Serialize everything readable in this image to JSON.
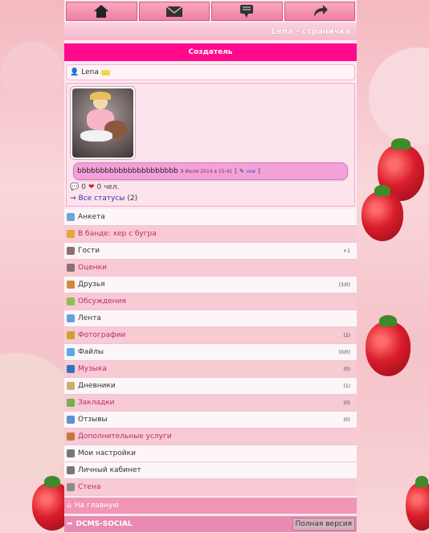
{
  "header": {
    "nav": [
      {
        "name": "home-icon"
      },
      {
        "name": "mail-icon"
      },
      {
        "name": "chat-icon"
      },
      {
        "name": "back-arrow-icon"
      }
    ],
    "page_title": "Lena - страничка"
  },
  "creator_label": "Создатель",
  "user": {
    "name": "Lena",
    "rank_badge": "...."
  },
  "status": {
    "text": "bbbbbbbbbbbbbbbbbbbbbb",
    "date": "9 Июля 2014 в 15:41",
    "new_label": "нов",
    "likes_count": "0",
    "people_count": "0 чел.",
    "all_statuses_label": "Все статусы",
    "all_statuses_count": "(2)"
  },
  "menu": [
    {
      "label": "Анкета",
      "style": "light",
      "icon": "user-icon",
      "count": ""
    },
    {
      "label": "В банде: хер с бугра",
      "style": "pink",
      "icon": "gang-icon",
      "count": ""
    },
    {
      "label": "Гости",
      "style": "light",
      "icon": "guests-icon",
      "count": "+1"
    },
    {
      "label": "Оценки",
      "style": "pink",
      "icon": "ratings-icon",
      "count": ""
    },
    {
      "label": "Друзья",
      "style": "light",
      "icon": "friends-icon",
      "count": "(3/0)"
    },
    {
      "label": "Обсуждения",
      "style": "pink",
      "icon": "discussions-icon",
      "count": ""
    },
    {
      "label": "Лента",
      "style": "light",
      "icon": "feed-icon",
      "count": ""
    },
    {
      "label": "Фотографии",
      "style": "pink",
      "icon": "photos-icon",
      "count": "(2)"
    },
    {
      "label": "Файлы",
      "style": "light",
      "icon": "files-icon",
      "count": "(0/0)"
    },
    {
      "label": "Музыка",
      "style": "pink",
      "icon": "music-icon",
      "count": "(0)"
    },
    {
      "label": "Дневники",
      "style": "light",
      "icon": "diary-icon",
      "count": "(1)"
    },
    {
      "label": "Закладки",
      "style": "pink",
      "icon": "bookmarks-icon",
      "count": "(0)"
    },
    {
      "label": "Отзывы",
      "style": "light",
      "icon": "reviews-icon",
      "count": "(0)"
    },
    {
      "label": "Дополнительные услуги",
      "style": "pink",
      "icon": "services-icon",
      "count": ""
    },
    {
      "label": "Мои настройки",
      "style": "light",
      "icon": "settings-icon",
      "count": ""
    },
    {
      "label": "Личный кабинет",
      "style": "light",
      "icon": "cabinet-icon",
      "count": ""
    },
    {
      "label": "Стена",
      "style": "pink",
      "icon": "wall-icon",
      "count": ""
    }
  ],
  "home_link": "На главную",
  "footer": {
    "site": "DCMS-SOCIAL",
    "full_version": "Полная версия"
  },
  "colors": {
    "accent": "#ff0a8c",
    "pink_row": "#f7cad4",
    "light_row": "#fdf6f8"
  }
}
